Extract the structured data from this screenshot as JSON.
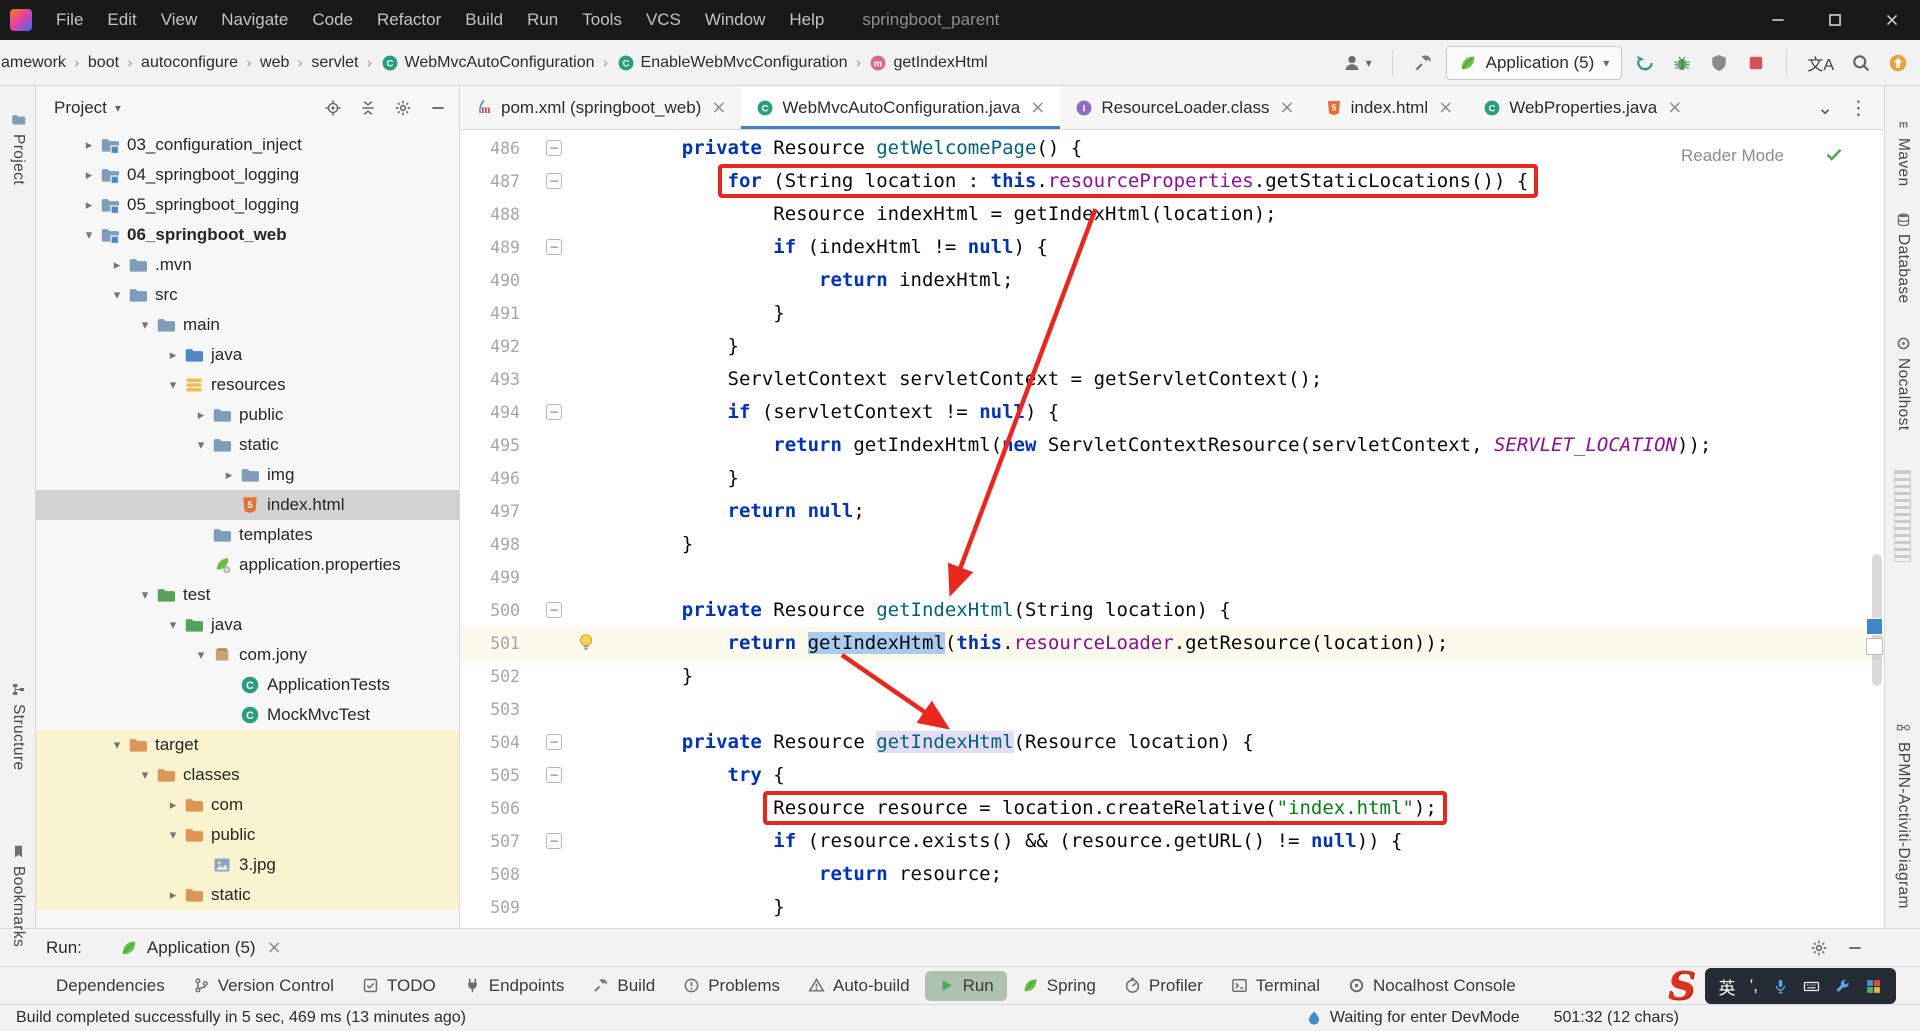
{
  "titlebar": {
    "menu": [
      "File",
      "Edit",
      "View",
      "Navigate",
      "Code",
      "Refactor",
      "Build",
      "Run",
      "Tools",
      "VCS",
      "Window",
      "Help"
    ],
    "title": "springboot_parent"
  },
  "navbar": {
    "breadcrumbs": [
      {
        "label": "amework"
      },
      {
        "label": "boot"
      },
      {
        "label": "autoconfigure"
      },
      {
        "label": "web"
      },
      {
        "label": "servlet"
      },
      {
        "label": "WebMvcAutoConfiguration",
        "icon": "class"
      },
      {
        "label": "EnableWebMvcConfiguration",
        "icon": "class"
      },
      {
        "label": "getIndexHtml",
        "icon": "method"
      }
    ],
    "run_config": "Application (5)",
    "translate_glyph": "文A"
  },
  "project_panel": {
    "title": "Project",
    "tree": [
      {
        "depth": 1,
        "chevron": "right",
        "icon": "module",
        "label": "03_configuration_inject"
      },
      {
        "depth": 1,
        "chevron": "right",
        "icon": "module",
        "label": "04_springboot_logging"
      },
      {
        "depth": 1,
        "chevron": "right",
        "icon": "module",
        "label": "05_springboot_logging"
      },
      {
        "depth": 1,
        "chevron": "down",
        "icon": "module",
        "label": "06_springboot_web",
        "bold": true
      },
      {
        "depth": 2,
        "chevron": "right",
        "icon": "folder",
        "label": ".mvn"
      },
      {
        "depth": 2,
        "chevron": "down",
        "icon": "folder",
        "label": "src"
      },
      {
        "depth": 3,
        "chevron": "down",
        "icon": "folder",
        "label": "main"
      },
      {
        "depth": 4,
        "chevron": "right",
        "icon": "folder-src",
        "label": "java"
      },
      {
        "depth": 4,
        "chevron": "down",
        "icon": "folder-res",
        "label": "resources"
      },
      {
        "depth": 5,
        "chevron": "right",
        "icon": "folder",
        "label": "public"
      },
      {
        "depth": 5,
        "chevron": "down",
        "icon": "folder",
        "label": "static"
      },
      {
        "depth": 6,
        "chevron": "right",
        "icon": "folder",
        "label": "img"
      },
      {
        "depth": 6,
        "chevron": "none",
        "icon": "html",
        "label": "index.html",
        "selected": true
      },
      {
        "depth": 5,
        "chevron": "none",
        "icon": "folder",
        "label": "templates"
      },
      {
        "depth": 5,
        "chevron": "none",
        "icon": "spring-config",
        "label": "application.properties"
      },
      {
        "depth": 3,
        "chevron": "down",
        "icon": "folder-test",
        "label": "test"
      },
      {
        "depth": 4,
        "chevron": "down",
        "icon": "folder-test",
        "label": "java"
      },
      {
        "depth": 5,
        "chevron": "down",
        "icon": "package",
        "label": "com.jony"
      },
      {
        "depth": 6,
        "chevron": "none",
        "icon": "class",
        "label": "ApplicationTests"
      },
      {
        "depth": 6,
        "chevron": "none",
        "icon": "class",
        "label": "MockMvcTest"
      },
      {
        "depth": 2,
        "chevron": "down",
        "icon": "folder-excl",
        "label": "target",
        "yellow": true
      },
      {
        "depth": 3,
        "chevron": "down",
        "icon": "folder-excl",
        "label": "classes",
        "yellow": true
      },
      {
        "depth": 4,
        "chevron": "right",
        "icon": "folder-excl",
        "label": "com",
        "yellow": true
      },
      {
        "depth": 4,
        "chevron": "down",
        "icon": "folder-excl",
        "label": "public",
        "yellow": true
      },
      {
        "depth": 5,
        "chevron": "none",
        "icon": "image",
        "label": "3.jpg",
        "yellow": true
      },
      {
        "depth": 4,
        "chevron": "right",
        "icon": "folder-excl",
        "label": "static",
        "yellow": true
      }
    ]
  },
  "editor": {
    "tabs": [
      {
        "label": "pom.xml (springboot_web)",
        "icon": "maven",
        "active": false
      },
      {
        "label": "WebMvcAutoConfiguration.java",
        "icon": "class",
        "active": true
      },
      {
        "label": "ResourceLoader.class",
        "icon": "interface",
        "active": false
      },
      {
        "label": "index.html",
        "icon": "html",
        "active": false
      },
      {
        "label": "WebProperties.java",
        "icon": "class",
        "active": false
      }
    ],
    "reader_mode_label": "Reader Mode",
    "code": {
      "lines": [
        {
          "n": 486,
          "f": true,
          "t": [
            [
              "sp",
              "    "
            ],
            [
              "k",
              "private"
            ],
            [
              "pl",
              " Resource "
            ],
            [
              "md",
              "getWelcomePage"
            ],
            [
              "pl",
              "() {"
            ]
          ]
        },
        {
          "n": 487,
          "f": true,
          "box": true,
          "t": [
            [
              "sp",
              "        "
            ],
            [
              "k",
              "for"
            ],
            [
              "pl",
              " (String location : "
            ],
            [
              "k",
              "this"
            ],
            [
              "pl",
              "."
            ],
            [
              "fd",
              "resourceProperties"
            ],
            [
              "pl",
              ".getStaticLocations()) {"
            ]
          ]
        },
        {
          "n": 488,
          "t": [
            [
              "sp",
              "            "
            ],
            [
              "pl",
              "Resource indexHtml = getIndexHtml(location);"
            ]
          ]
        },
        {
          "n": 489,
          "f": true,
          "t": [
            [
              "sp",
              "            "
            ],
            [
              "k",
              "if"
            ],
            [
              "pl",
              " (indexHtml != "
            ],
            [
              "k",
              "null"
            ],
            [
              "pl",
              ") {"
            ]
          ]
        },
        {
          "n": 490,
          "t": [
            [
              "sp",
              "                "
            ],
            [
              "k",
              "return"
            ],
            [
              "pl",
              " indexHtml;"
            ]
          ]
        },
        {
          "n": 491,
          "t": [
            [
              "sp",
              "            "
            ],
            [
              "pl",
              "}"
            ]
          ]
        },
        {
          "n": 492,
          "t": [
            [
              "sp",
              "        "
            ],
            [
              "pl",
              "}"
            ]
          ]
        },
        {
          "n": 493,
          "t": [
            [
              "sp",
              "        "
            ],
            [
              "pl",
              "ServletContext servletContext = getServletContext();"
            ]
          ]
        },
        {
          "n": 494,
          "f": true,
          "t": [
            [
              "sp",
              "        "
            ],
            [
              "k",
              "if"
            ],
            [
              "pl",
              " (servletContext != "
            ],
            [
              "k",
              "null"
            ],
            [
              "pl",
              ") {"
            ]
          ]
        },
        {
          "n": 495,
          "t": [
            [
              "sp",
              "            "
            ],
            [
              "k",
              "return"
            ],
            [
              "pl",
              " getIndexHtml("
            ],
            [
              "k",
              "new"
            ],
            [
              "pl",
              " ServletContextResource(servletContext, "
            ],
            [
              "cf",
              "SERVLET_LOCATION"
            ],
            [
              "pl",
              "));"
            ]
          ]
        },
        {
          "n": 496,
          "t": [
            [
              "sp",
              "        "
            ],
            [
              "pl",
              "}"
            ]
          ]
        },
        {
          "n": 497,
          "t": [
            [
              "sp",
              "        "
            ],
            [
              "k",
              "return"
            ],
            [
              "pl",
              " "
            ],
            [
              "k",
              "null"
            ],
            [
              "pl",
              ";"
            ]
          ]
        },
        {
          "n": 498,
          "t": [
            [
              "sp",
              "    "
            ],
            [
              "pl",
              "}"
            ]
          ]
        },
        {
          "n": 499,
          "t": []
        },
        {
          "n": 500,
          "f": true,
          "t": [
            [
              "sp",
              "    "
            ],
            [
              "k",
              "private"
            ],
            [
              "pl",
              " Resource "
            ],
            [
              "md",
              "getIndexHtml"
            ],
            [
              "pl",
              "(String location) {"
            ]
          ]
        },
        {
          "n": 501,
          "cur": true,
          "bulb": true,
          "t": [
            [
              "sp",
              "        "
            ],
            [
              "k",
              "return"
            ],
            [
              "pl",
              " "
            ],
            [
              "hlb",
              "getIndexHtml"
            ],
            [
              "pl",
              "("
            ],
            [
              "k",
              "this"
            ],
            [
              "pl",
              "."
            ],
            [
              "fd",
              "resourceLoader"
            ],
            [
              "pl",
              ".getResource(location));"
            ]
          ]
        },
        {
          "n": 502,
          "t": [
            [
              "sp",
              "    "
            ],
            [
              "pl",
              "}"
            ]
          ]
        },
        {
          "n": 503,
          "t": []
        },
        {
          "n": 504,
          "f": true,
          "t": [
            [
              "sp",
              "    "
            ],
            [
              "k",
              "private"
            ],
            [
              "pl",
              " Resource "
            ],
            [
              "mdh",
              "getIndexHtml"
            ],
            [
              "pl",
              "(Resource location) {"
            ]
          ]
        },
        {
          "n": 505,
          "f": true,
          "t": [
            [
              "sp",
              "        "
            ],
            [
              "k",
              "try"
            ],
            [
              "pl",
              " {"
            ]
          ]
        },
        {
          "n": 506,
          "box": true,
          "t": [
            [
              "sp",
              "            "
            ],
            [
              "pl",
              "Resource resource = location.createRelative("
            ],
            [
              "st",
              "\"index.html\""
            ],
            [
              "pl",
              ");"
            ]
          ]
        },
        {
          "n": 507,
          "f": true,
          "t": [
            [
              "sp",
              "            "
            ],
            [
              "k",
              "if"
            ],
            [
              "pl",
              " (resource.exists() && (resource.getURL() != "
            ],
            [
              "k",
              "null"
            ],
            [
              "pl",
              ")) {"
            ]
          ]
        },
        {
          "n": 508,
          "t": [
            [
              "sp",
              "                "
            ],
            [
              "k",
              "return"
            ],
            [
              "pl",
              " resource;"
            ]
          ]
        },
        {
          "n": 509,
          "t": [
            [
              "sp",
              "            "
            ],
            [
              "pl",
              "}"
            ]
          ]
        }
      ]
    }
  },
  "left_stripe": {
    "items": [
      {
        "label": "Project",
        "icon": "folder"
      },
      {
        "label": "Structure",
        "icon": "structure"
      },
      {
        "label": "Bookmarks",
        "icon": "bookmark"
      }
    ]
  },
  "right_stripe": {
    "items": [
      {
        "label": "Maven",
        "icon": "maven-stripe"
      },
      {
        "label": "Database",
        "icon": "database"
      },
      {
        "label": "Nocalhost",
        "icon": "nocalhost"
      },
      {
        "label": "BPMN-Activiti-Diagram",
        "icon": "bpmn"
      }
    ]
  },
  "run_panel": {
    "label": "Run:",
    "tab": "Application (5)"
  },
  "toolwindow_bar": {
    "items": [
      {
        "label": "Dependencies",
        "icon": "dependencies"
      },
      {
        "label": "Version Control",
        "icon": "branch"
      },
      {
        "label": "TODO",
        "icon": "todo"
      },
      {
        "label": "Endpoints",
        "icon": "endpoints"
      },
      {
        "label": "Build",
        "icon": "hammer"
      },
      {
        "label": "Problems",
        "icon": "problems"
      },
      {
        "label": "Auto-build",
        "icon": "problems-tri"
      },
      {
        "label": "Run",
        "icon": "play",
        "active": true
      },
      {
        "label": "Spring",
        "icon": "spring-leaf"
      },
      {
        "label": "Profiler",
        "icon": "profiler"
      },
      {
        "label": "Terminal",
        "icon": "terminal"
      },
      {
        "label": "Nocalhost Console",
        "icon": "nocalhost"
      }
    ]
  },
  "statusbar": {
    "message": "Build completed successfully in 5 sec, 469 ms (13 minutes ago)",
    "devmode": "Waiting for enter DevMode",
    "caret": "501:32 (12 chars)"
  },
  "ime": {
    "logo": "S",
    "lang": "英",
    "punct": "’,"
  },
  "colors": {
    "accent": "#4083c4",
    "annotation": "#e8271f",
    "selection": "#a9ccee",
    "current_line": "#fcfaed",
    "excluded_row": "#faf3cf",
    "run_active": "#aec0ae",
    "decl_highlight": "#e3def5"
  }
}
